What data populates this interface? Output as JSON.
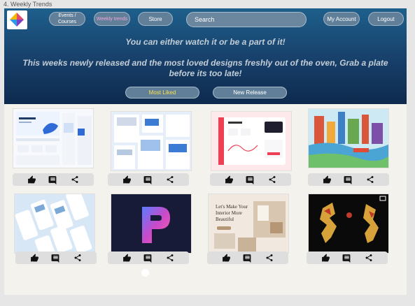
{
  "frame_label": "4. Weekly Trends",
  "nav": {
    "events_label": "Events / Courses",
    "weekly_label": "Weekly trends",
    "store_label": "Store",
    "search_placeholder": "Search",
    "account_label": "My Account",
    "logout_label": "Logout"
  },
  "hero": {
    "tagline1": "You can either watch it or be a part of it!",
    "tagline2": "This weeks newly released and the most loved designs freshly out of the oven, Grab a plate before its too late!"
  },
  "filters": {
    "most_liked": "Most Liked",
    "new_release": "New Release"
  },
  "cards": [
    {
      "caption": "",
      "colors": [
        "#ffffff",
        "#2f6bd6"
      ]
    },
    {
      "caption": "",
      "colors": [
        "#e9f1fb",
        "#3b7bd4"
      ]
    },
    {
      "caption": "",
      "colors": [
        "#fde6ea",
        "#ee4055"
      ]
    },
    {
      "caption": "",
      "colors": [
        "#bfe6f2",
        "#d9563a"
      ]
    },
    {
      "caption": "",
      "colors": [
        "#dbeaf7",
        "#7aa9d8"
      ]
    },
    {
      "caption": "",
      "colors": [
        "#1a1f3e",
        "#c94ac9"
      ]
    },
    {
      "caption": "Let's Make Your Interior More Beautiful",
      "colors": [
        "#efe6dc",
        "#b59776"
      ]
    },
    {
      "caption": "",
      "colors": [
        "#0b0b0b",
        "#d8a23b"
      ]
    }
  ],
  "icons": {
    "like": "thumbs-up-icon",
    "comment": "comment-icon",
    "share": "share-icon"
  }
}
